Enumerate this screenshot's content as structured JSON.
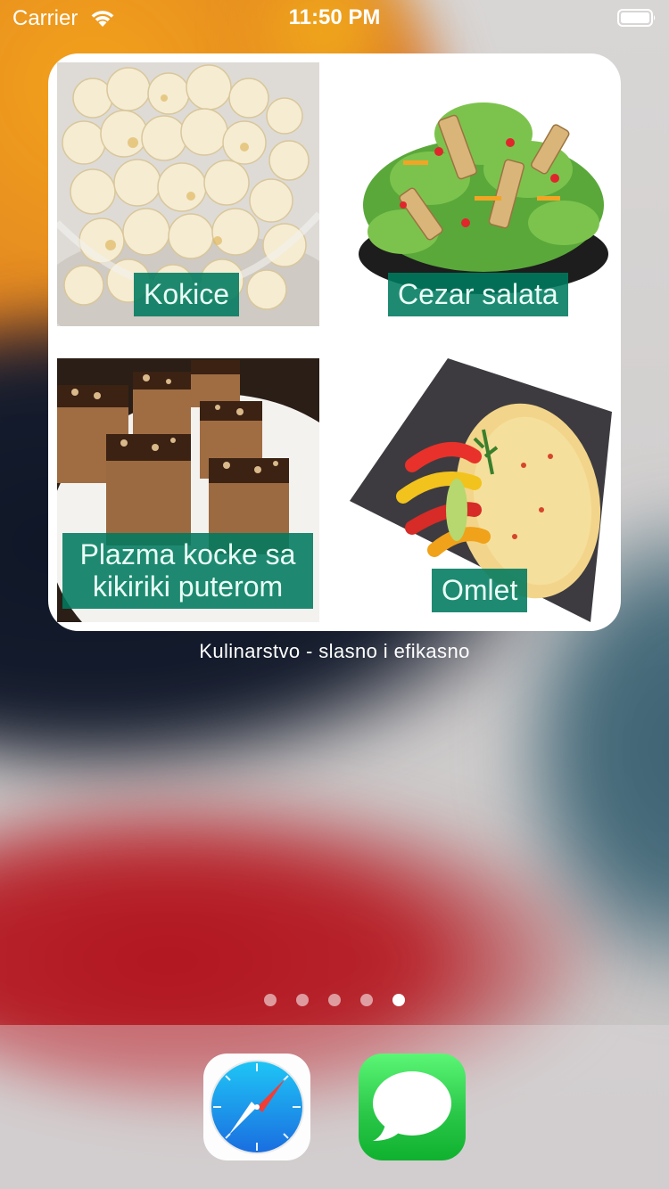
{
  "status_bar": {
    "carrier": "Carrier",
    "time": "11:50 PM"
  },
  "widget": {
    "caption": "Kulinarstvo - slasno i efikasno",
    "tiles": [
      {
        "label": "Kokice"
      },
      {
        "label": "Cezar salata"
      },
      {
        "label": "Plazma kocke sa kikiriki puterom"
      },
      {
        "label": "Omlet"
      }
    ],
    "label_color": "#007a5e"
  },
  "page_indicator": {
    "count": 5,
    "active_index": 4
  },
  "dock": {
    "apps": [
      "Safari",
      "Messages"
    ]
  },
  "icons": [
    "wifi-icon",
    "battery-icon",
    "safari-icon",
    "messages-icon"
  ]
}
